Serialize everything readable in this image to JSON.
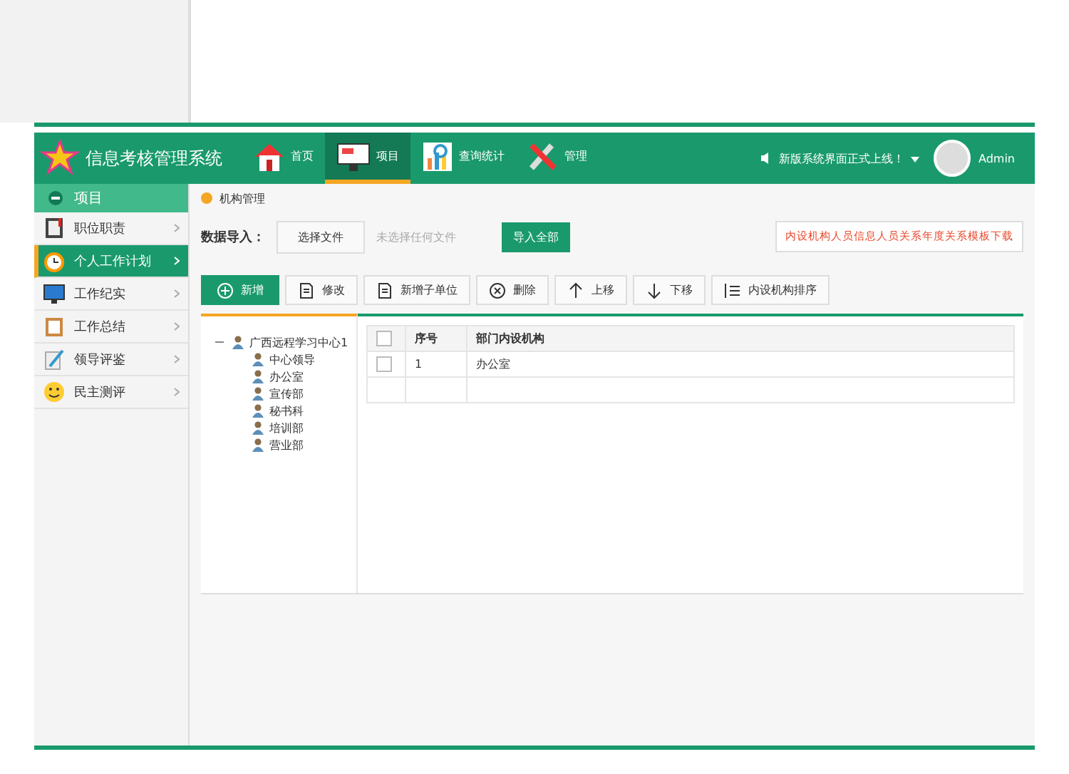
{
  "header": {
    "title": "信息考核管理系统",
    "nav": [
      {
        "label": "首页",
        "selected": false
      },
      {
        "label": "项目",
        "selected": true
      },
      {
        "label": "查询统计",
        "selected": false
      },
      {
        "label": "管理",
        "selected": false
      }
    ],
    "notice": "新版系统界面正式上线！",
    "user": "Admin"
  },
  "sidebar": {
    "heading": "项目",
    "items": [
      {
        "label": "职位职责",
        "selected": false
      },
      {
        "label": "个人工作计划",
        "selected": true
      },
      {
        "label": "工作纪实",
        "selected": false
      },
      {
        "label": "工作总结",
        "selected": false
      },
      {
        "label": "领导评鉴",
        "selected": false
      },
      {
        "label": "民主测评",
        "selected": false
      }
    ]
  },
  "breadcrumb": "机构管理",
  "import": {
    "label": "数据导入：",
    "file_button": "选择文件",
    "file_status": "未选择任何文件",
    "submit": "导入全部",
    "template_link": "内设机构人员信息人员关系年度关系模板下载"
  },
  "toolbar": [
    {
      "label": "新增"
    },
    {
      "label": "修改"
    },
    {
      "label": "新增子单位"
    },
    {
      "label": "删除"
    },
    {
      "label": "上移"
    },
    {
      "label": "下移"
    },
    {
      "label": "内设机构排序"
    }
  ],
  "tree": [
    {
      "label": "广西远程学习中心1",
      "expanded": true,
      "children": [
        {
          "label": "中心领导"
        },
        {
          "label": "办公室"
        },
        {
          "label": "宣传部"
        },
        {
          "label": "秘书科"
        },
        {
          "label": "培训部"
        },
        {
          "label": "营业部"
        }
      ]
    }
  ],
  "table": {
    "all_checked": false,
    "columns": [
      "序号",
      "部门内设机构"
    ],
    "rows": [
      {
        "cells": [
          "1",
          "办公室"
        ],
        "checked": false
      }
    ]
  }
}
